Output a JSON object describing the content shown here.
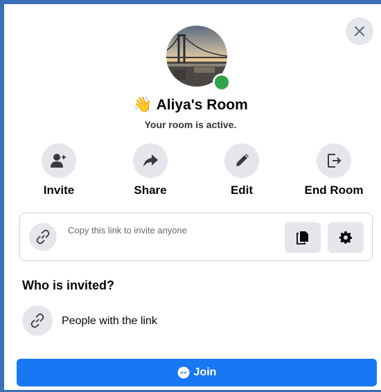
{
  "room": {
    "wave_emoji": "👋",
    "title": "Aliya's Room",
    "status": "Your room is active."
  },
  "actions": [
    {
      "label": "Invite",
      "icon": "add-person-icon"
    },
    {
      "label": "Share",
      "icon": "share-arrow-icon"
    },
    {
      "label": "Edit",
      "icon": "pencil-icon"
    },
    {
      "label": "End Room",
      "icon": "exit-door-icon"
    }
  ],
  "link_box": {
    "text": "Copy this link to invite anyone",
    "copy_icon": "copy-icon",
    "settings_icon": "gear-icon"
  },
  "invited": {
    "heading": "Who is invited?",
    "option": "People with the link"
  },
  "join_button": {
    "label": "Join",
    "icon": "messenger-icon"
  },
  "colors": {
    "primary": "#1877f2",
    "online": "#31a24c",
    "icon_bg": "#e4e6eb",
    "frame": "#3b6fb6"
  }
}
